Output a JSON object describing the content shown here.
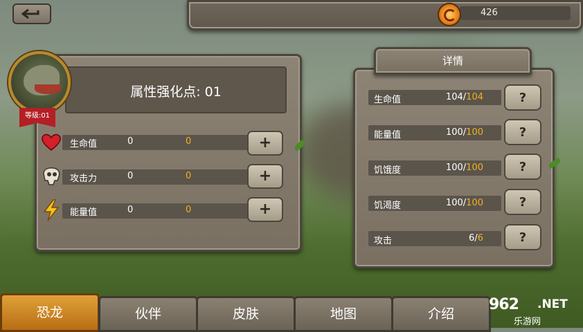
{
  "topbar": {
    "coins": "426"
  },
  "left_panel": {
    "level": "等级:01",
    "title": "属性强化点: 01",
    "stats": [
      {
        "label": "生命值",
        "value": "0",
        "bonus": "0"
      },
      {
        "label": "攻击力",
        "value": "0",
        "bonus": "0"
      },
      {
        "label": "能量值",
        "value": "0",
        "bonus": "0"
      }
    ],
    "plus_label": "+"
  },
  "details": {
    "header": "详情",
    "rows": [
      {
        "label": "生命值",
        "current": "104",
        "max": "104"
      },
      {
        "label": "能量值",
        "current": "100",
        "max": "100"
      },
      {
        "label": "饥饿度",
        "current": "100",
        "max": "100"
      },
      {
        "label": "饥渴度",
        "current": "100",
        "max": "100"
      },
      {
        "label": "攻击",
        "current": "6",
        "max": "6"
      }
    ],
    "help_label": "?"
  },
  "tabs": [
    "恐龙",
    "伙伴",
    "皮肤",
    "地图",
    "介绍"
  ],
  "watermark": {
    "num": "962",
    "net": ".NET",
    "cn": "乐游网"
  },
  "colors": {
    "accent": "#f2b21e",
    "active_tab": "#d48a26"
  }
}
